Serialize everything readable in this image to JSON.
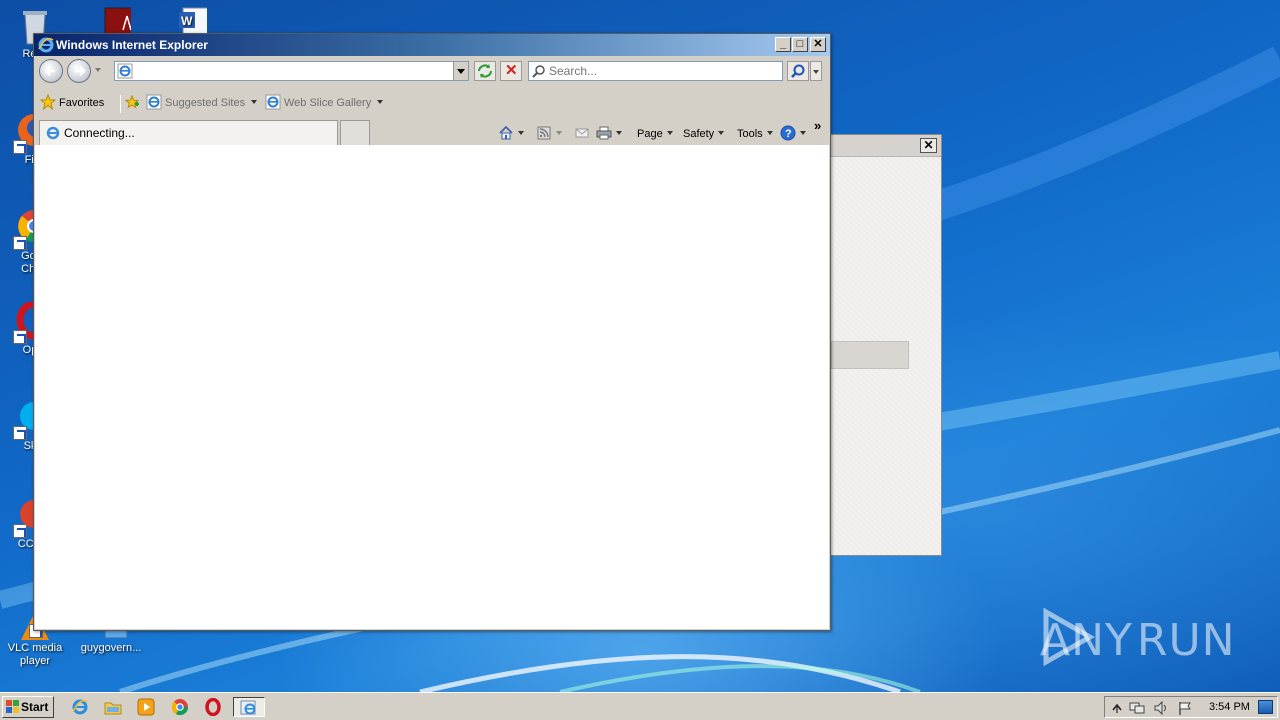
{
  "desktop": {
    "icons": [
      {
        "label": "Recy",
        "name": "recycle-bin"
      },
      {
        "label": "",
        "name": "acrobat"
      },
      {
        "label": "",
        "name": "word-document"
      },
      {
        "label": "Fir",
        "name": "firefox"
      },
      {
        "label": "Go\nChr",
        "name": "google-chrome"
      },
      {
        "label": "Op",
        "name": "opera"
      },
      {
        "label": "Sk",
        "name": "skype"
      },
      {
        "label": "CCle",
        "name": "ccleaner"
      },
      {
        "label": "VLC media player",
        "name": "vlc-media-player"
      },
      {
        "label": "guygovern...",
        "name": "file-guygovern"
      }
    ],
    "watermark": {
      "left": "ANY",
      "right": "RUN"
    }
  },
  "ie_window": {
    "title": "Windows Internet Explorer",
    "address": {
      "value": "",
      "placeholder": ""
    },
    "search": {
      "placeholder": "Search..."
    },
    "favorites": {
      "favorites_label": "Favorites",
      "items": [
        {
          "label": "Suggested Sites"
        },
        {
          "label": "Web Slice Gallery"
        }
      ]
    },
    "tab": {
      "label": "Connecting..."
    },
    "commands": {
      "page": "Page",
      "safety": "Safety",
      "tools": "Tools",
      "more": "»"
    },
    "window_buttons": {
      "minimize": "_",
      "maximize": "□",
      "close": "✕"
    }
  },
  "bg_dialog": {
    "close": "✕"
  },
  "taskbar": {
    "start_label": "Start",
    "clock": "3:54 PM",
    "apps": [
      "internet-explorer",
      "windows-explorer",
      "media-player",
      "chrome",
      "opera",
      "ie-active-task"
    ]
  },
  "colors": {
    "titlebar_start": "#0a246a",
    "titlebar_end": "#a6caf0",
    "desktop": "#1565b8",
    "chrome_face": "#d4d0c8"
  }
}
